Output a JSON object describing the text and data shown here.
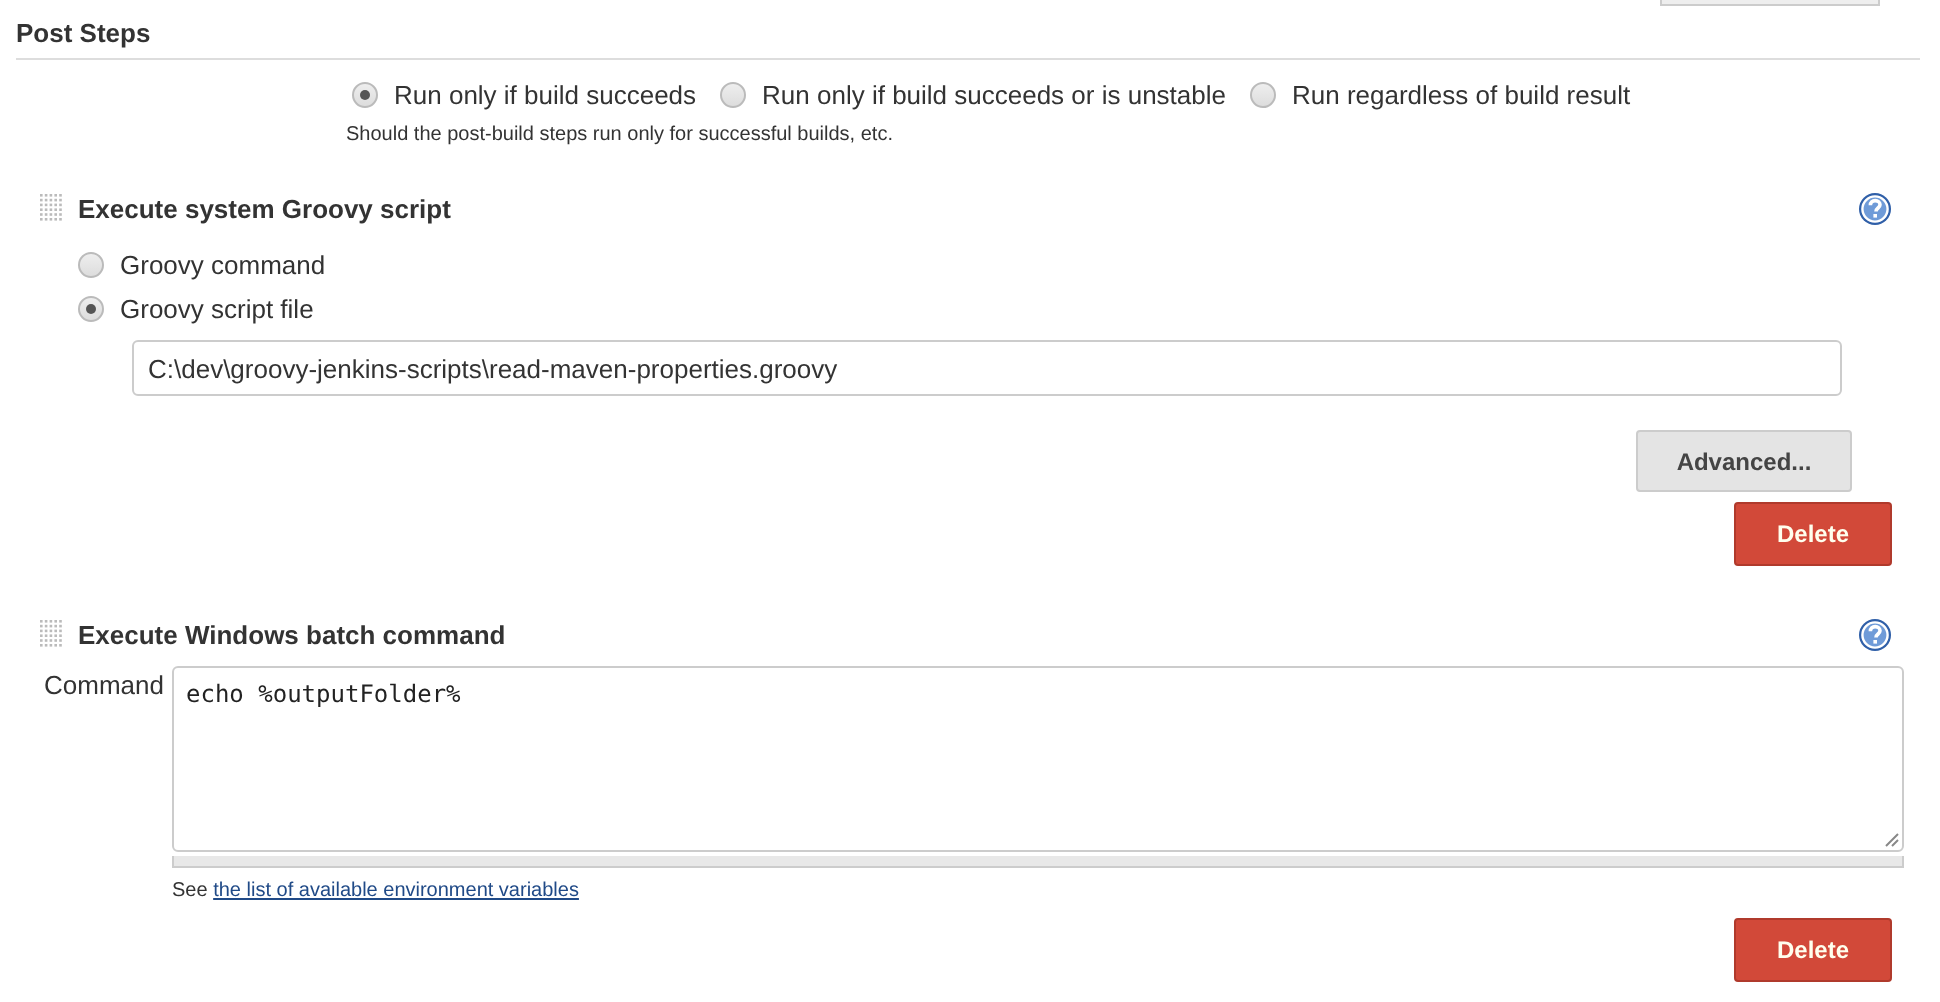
{
  "post_steps": {
    "title": "Post Steps",
    "options": [
      {
        "label": "Run only if build succeeds",
        "selected": true
      },
      {
        "label": "Run only if build succeeds or is unstable",
        "selected": false
      },
      {
        "label": "Run regardless of build result",
        "selected": false
      }
    ],
    "hint": "Should the post-build steps run only for successful builds, etc."
  },
  "build_steps": [
    {
      "kind": "groovy",
      "title": "Execute system Groovy script",
      "options": [
        {
          "label": "Groovy command",
          "selected": false
        },
        {
          "label": "Groovy script file",
          "selected": true
        }
      ],
      "script_file": "C:\\dev\\groovy-jenkins-scripts\\read-maven-properties.groovy",
      "advanced_button": "Advanced...",
      "delete_button": "Delete"
    },
    {
      "kind": "batch",
      "title": "Execute Windows batch command",
      "command_label": "Command",
      "command": "echo %outputFolder%",
      "note_prefix": "See",
      "note_link": "the list of available environment variables",
      "delete_button": "Delete"
    }
  ]
}
